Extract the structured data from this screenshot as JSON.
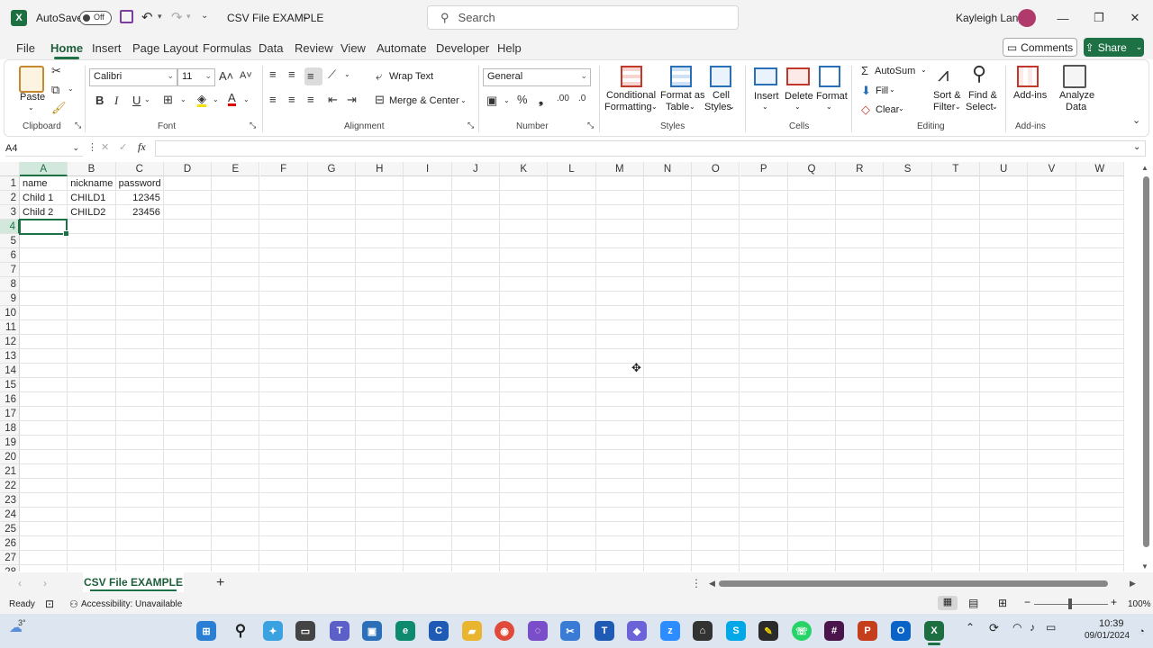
{
  "titlebar": {
    "autosave_label": "AutoSave",
    "autosave_state": "Off",
    "file_name": "CSV File EXAMPLE",
    "search_placeholder": "Search",
    "user_name": "Kayleigh Lang"
  },
  "menu": {
    "tabs": [
      "File",
      "Home",
      "Insert",
      "Page Layout",
      "Formulas",
      "Data",
      "Review",
      "View",
      "Automate",
      "Developer",
      "Help"
    ],
    "active": "Home",
    "comments_label": "Comments",
    "share_label": "Share"
  },
  "ribbon": {
    "clipboard": {
      "label": "Clipboard",
      "paste": "Paste"
    },
    "font": {
      "label": "Font",
      "name": "Calibri",
      "size": "11"
    },
    "alignment": {
      "label": "Alignment",
      "wrap_text": "Wrap Text",
      "merge_center": "Merge & Center"
    },
    "number": {
      "label": "Number",
      "format": "General"
    },
    "styles": {
      "label": "Styles",
      "conditional_1": "Conditional",
      "conditional_2": "Formatting",
      "format_table_1": "Format as",
      "format_table_2": "Table",
      "cell_styles_1": "Cell",
      "cell_styles_2": "Styles"
    },
    "cells": {
      "label": "Cells",
      "insert": "Insert",
      "delete": "Delete",
      "format": "Format"
    },
    "editing": {
      "label": "Editing",
      "autosum": "AutoSum",
      "fill": "Fill",
      "clear": "Clear",
      "sort_1": "Sort &",
      "sort_2": "Filter",
      "find_1": "Find &",
      "find_2": "Select"
    },
    "addins": {
      "label": "Add-ins",
      "addins": "Add-ins",
      "analyze_1": "Analyze",
      "analyze_2": "Data"
    }
  },
  "formula_bar": {
    "name_box": "A4",
    "fx": "fx",
    "value": ""
  },
  "sheet": {
    "columns": [
      "A",
      "B",
      "C",
      "D",
      "E",
      "F",
      "G",
      "H",
      "I",
      "J",
      "K",
      "L",
      "M",
      "N",
      "O",
      "P",
      "Q",
      "R",
      "S",
      "T",
      "U",
      "V",
      "W"
    ],
    "rows": [
      "1",
      "2",
      "3",
      "4",
      "5",
      "6",
      "7",
      "8",
      "9",
      "10",
      "11",
      "12",
      "13",
      "14",
      "15",
      "16",
      "17",
      "18",
      "19",
      "20",
      "21",
      "22",
      "23",
      "24",
      "25",
      "26",
      "27"
    ],
    "last_row_partial": "28",
    "active_cell": "A4",
    "cells": [
      [
        "name",
        "nickname",
        "password"
      ],
      [
        "Child 1",
        "CHILD1",
        "12345"
      ],
      [
        "Child 2",
        "CHILD2",
        "23456"
      ]
    ]
  },
  "sheet_tabs": {
    "active": "CSV File EXAMPLE",
    "add": "+"
  },
  "status": {
    "ready": "Ready",
    "accessibility": "Accessibility: Unavailable",
    "zoom": "100%"
  },
  "taskbar": {
    "weather": "3°",
    "time": "10:39",
    "date": "09/01/2024"
  },
  "colors": {
    "excel_green": "#1e7145",
    "selection": "#d3e8dc"
  }
}
